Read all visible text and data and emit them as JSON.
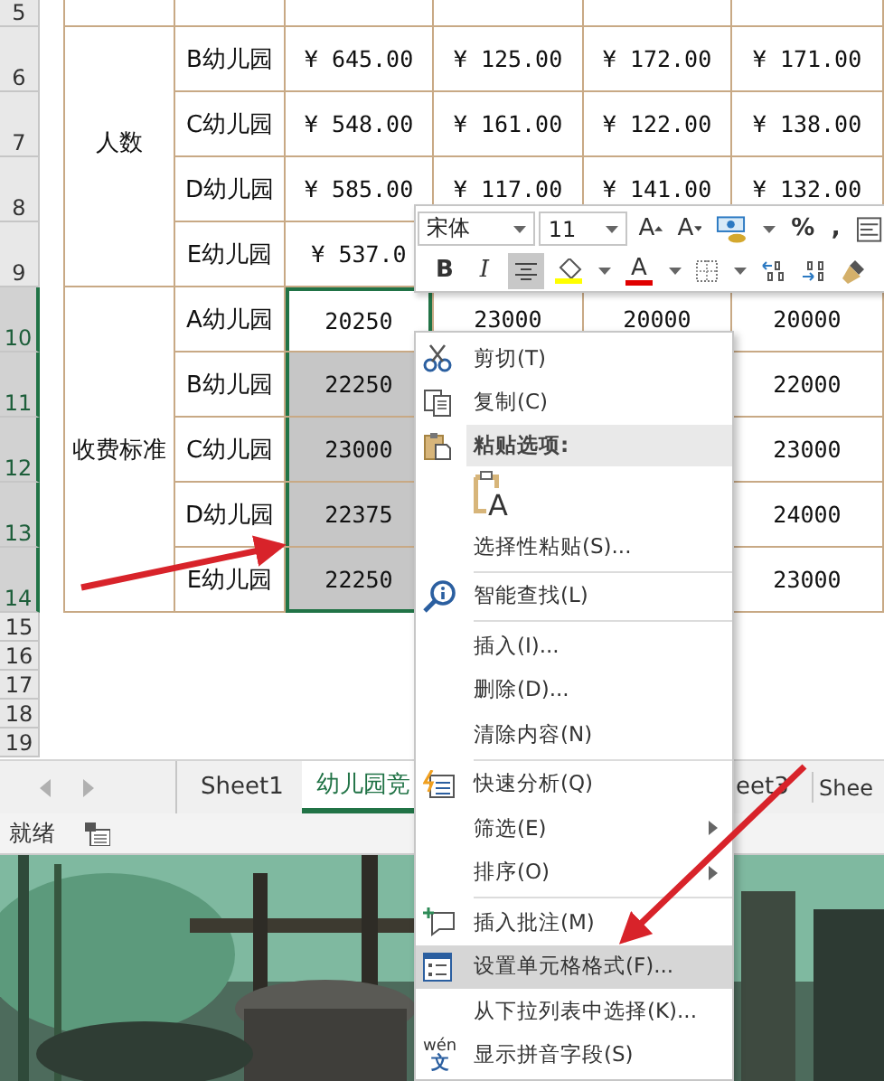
{
  "row_headers": [
    {
      "number": "5",
      "selected": false
    },
    {
      "number": "6",
      "selected": false
    },
    {
      "number": "7",
      "selected": false
    },
    {
      "number": "8",
      "selected": false
    },
    {
      "number": "9",
      "selected": false
    },
    {
      "number": "10",
      "selected": true
    },
    {
      "number": "11",
      "selected": true
    },
    {
      "number": "12",
      "selected": true
    },
    {
      "number": "13",
      "selected": true
    },
    {
      "number": "14",
      "selected": true
    },
    {
      "number": "15",
      "selected": false
    },
    {
      "number": "16",
      "selected": false
    },
    {
      "number": "17",
      "selected": false
    },
    {
      "number": "18",
      "selected": false
    },
    {
      "number": "19",
      "selected": false
    }
  ],
  "table": {
    "groups": [
      {
        "label": "人数",
        "rows": [
          {
            "name": "B幼儿园",
            "column_d": "¥ 645.00",
            "column_e": "¥ 125.00",
            "column_f": "¥ 172.00",
            "column_g": "¥ 171.00",
            "selected": false,
            "active": false
          },
          {
            "name": "C幼儿园",
            "column_d": "¥ 548.00",
            "column_e": "¥ 161.00",
            "column_f": "¥ 122.00",
            "column_g": "¥ 138.00",
            "selected": false,
            "active": false
          },
          {
            "name": "D幼儿园",
            "column_d": "¥ 585.00",
            "column_e": "¥ 117.00",
            "column_f": "¥ 141.00",
            "column_g": "¥ 132.00",
            "selected": false,
            "active": false
          },
          {
            "name": "E幼儿园",
            "column_d": "¥ 537.0",
            "selected": false,
            "active": false
          }
        ]
      },
      {
        "label": "收费标准",
        "rows": [
          {
            "name": "A幼儿园",
            "column_d": "20250",
            "column_e": "23000",
            "column_f": "20000",
            "column_g": "20000",
            "selected": true,
            "active": true
          },
          {
            "name": "B幼儿园",
            "column_d": "22250",
            "column_g": "22000",
            "selected": true,
            "active": false
          },
          {
            "name": "C幼儿园",
            "column_d": "23000",
            "column_g": "23000",
            "selected": true,
            "active": false
          },
          {
            "name": "D幼儿园",
            "column_d": "22375",
            "column_g": "24000",
            "selected": true,
            "active": false
          },
          {
            "name": "E幼儿园",
            "column_d": "22250",
            "column_g": "23000",
            "selected": true,
            "active": false
          }
        ]
      }
    ]
  },
  "sheet_tabs": [
    {
      "label": "Sheet1",
      "selected": false
    },
    {
      "label": "幼儿园竞",
      "selected": true
    },
    {
      "label": "eet3",
      "selected": false
    },
    {
      "label": "Shee",
      "selected": false
    }
  ],
  "status_bar": {
    "text": "就绪"
  },
  "mini_toolbar": {
    "font": "宋体",
    "size": "11",
    "row_1": [
      {
        "kind": "grow_font",
        "label": "A"
      },
      {
        "kind": "shrink_font",
        "label": "A"
      },
      {
        "kind": "accounting"
      },
      {
        "kind": "dropdown"
      },
      {
        "kind": "text",
        "label": "%"
      },
      {
        "kind": "text",
        "label": ","
      },
      {
        "kind": "wrap"
      }
    ],
    "row_2": [
      {
        "kind": "toggle",
        "label": "B",
        "selected": false
      },
      {
        "kind": "italic",
        "label": "I",
        "selected": false
      },
      {
        "kind": "center",
        "selected": true
      },
      {
        "kind": "fill",
        "color": "#ffff00"
      },
      {
        "kind": "dropdown"
      },
      {
        "kind": "font_color",
        "label": "A",
        "color": "#e00000"
      },
      {
        "kind": "dropdown"
      },
      {
        "kind": "borders"
      },
      {
        "kind": "dropdown"
      },
      {
        "kind": "increase_decimal"
      },
      {
        "kind": "decrease_decimal"
      },
      {
        "kind": "painter"
      }
    ]
  },
  "context_menu": [
    {
      "kind": "command",
      "label": "剪切(T)",
      "selected": false
    },
    {
      "kind": "command",
      "label": "复制(C)",
      "selected": false
    },
    {
      "kind": "header",
      "label": "粘贴选项:"
    },
    {
      "kind": "paste_option",
      "label": "A"
    },
    {
      "kind": "command",
      "label": "选择性粘贴(S)...",
      "selected": false
    },
    {
      "kind": "separator"
    },
    {
      "kind": "command",
      "label": "智能查找(L)",
      "selected": false
    },
    {
      "kind": "separator"
    },
    {
      "kind": "command",
      "label": "插入(I)...",
      "selected": false
    },
    {
      "kind": "command",
      "label": "删除(D)...",
      "selected": false
    },
    {
      "kind": "command",
      "label": "清除内容(N)",
      "selected": false
    },
    {
      "kind": "separator"
    },
    {
      "kind": "command",
      "label": "快速分析(Q)",
      "selected": false
    },
    {
      "kind": "command",
      "label": "筛选(E)",
      "selected": false,
      "submenu": true
    },
    {
      "kind": "command",
      "label": "排序(O)",
      "selected": false,
      "submenu": true
    },
    {
      "kind": "separator"
    },
    {
      "kind": "command",
      "label": "插入批注(M)",
      "selected": false
    },
    {
      "kind": "command",
      "label": "设置单元格格式(F)...",
      "selected": true
    },
    {
      "kind": "command",
      "label": "从下拉列表中选择(K)...",
      "selected": false
    },
    {
      "kind": "command",
      "label": "显示拼音字段(S)",
      "selected": false,
      "icon_text": [
        "wén",
        "文"
      ]
    }
  ]
}
